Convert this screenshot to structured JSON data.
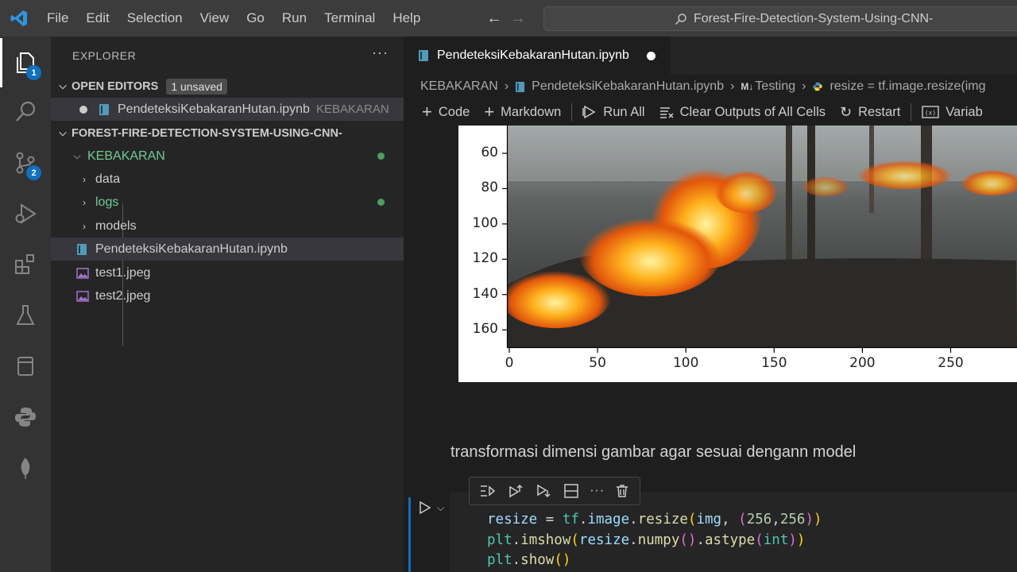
{
  "menu": [
    "File",
    "Edit",
    "Selection",
    "View",
    "Go",
    "Run",
    "Terminal",
    "Help"
  ],
  "search": {
    "text": "Forest-Fire-Detection-System-Using-CNN-",
    "icon": "search-icon"
  },
  "activity": {
    "explorer_badge": "1",
    "scm_badge": "2"
  },
  "sidebar": {
    "title": "EXPLORER",
    "more": "···",
    "open_editors": {
      "label": "OPEN EDITORS",
      "unsaved": "1 unsaved",
      "file": "PendeteksiKebakaranHutan.ipynb",
      "folder": "KEBAKARAN"
    },
    "project": "FOREST-FIRE-DETECTION-SYSTEM-USING-CNN-",
    "folder": "KEBAKARAN",
    "items": [
      {
        "label": "data"
      },
      {
        "label": "logs"
      },
      {
        "label": "models"
      },
      {
        "label": "PendeteksiKebakaranHutan.ipynb"
      },
      {
        "label": "test1.jpeg"
      },
      {
        "label": "test2.jpeg"
      }
    ]
  },
  "editor": {
    "tab": "PendeteksiKebakaranHutan.ipynb",
    "breadcrumbs": {
      "folder": "KEBAKARAN",
      "file": "PendeteksiKebakaranHutan.ipynb",
      "section": "Testing",
      "symbol": "resize = tf.image.resize(img"
    },
    "toolbar": {
      "code": "Code",
      "markdown": "Markdown",
      "run_all": "Run All",
      "clear": "Clear Outputs of All Cells",
      "restart": "Restart",
      "variables": "Variab"
    },
    "markdown": "transformasi dimensi gambar agar sesuai dengann model"
  },
  "chart_data": {
    "type": "image",
    "y_ticks": [
      "60",
      "80",
      "100",
      "120",
      "140",
      "160"
    ],
    "x_ticks": [
      "0",
      "50",
      "100",
      "150",
      "200",
      "250"
    ]
  },
  "colors": {
    "accent": "#0e70c0",
    "green": "#73c991"
  }
}
